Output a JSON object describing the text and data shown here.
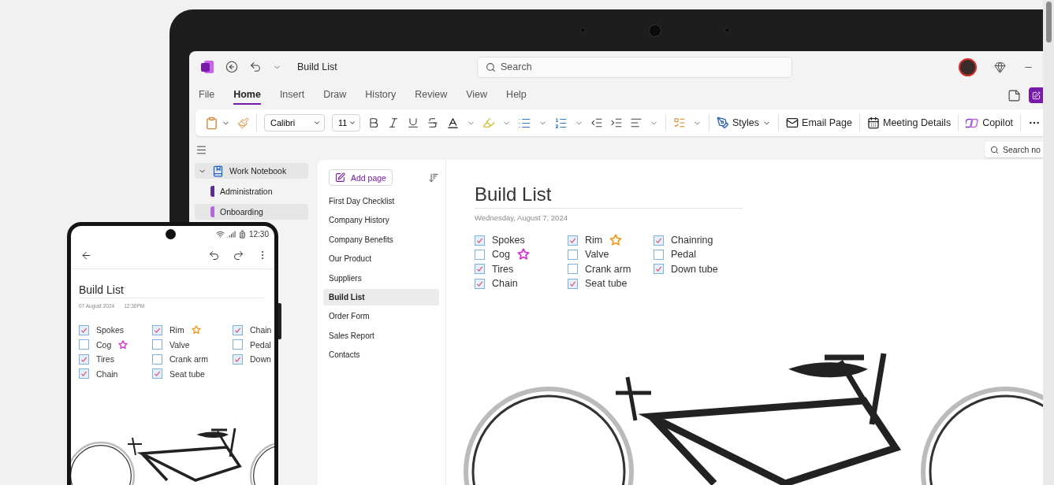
{
  "app": {
    "title": "Build List",
    "search_placeholder": "Search"
  },
  "tabs": [
    {
      "label": "File",
      "selected": false
    },
    {
      "label": "Home",
      "selected": true
    },
    {
      "label": "Insert",
      "selected": false
    },
    {
      "label": "Draw",
      "selected": false
    },
    {
      "label": "History",
      "selected": false
    },
    {
      "label": "Review",
      "selected": false
    },
    {
      "label": "View",
      "selected": false
    },
    {
      "label": "Help",
      "selected": false
    }
  ],
  "ribbon": {
    "font": "Calibri",
    "size": "11",
    "styles": "Styles",
    "actions": [
      {
        "kind": "email",
        "label": "Email Page"
      },
      {
        "kind": "meeting",
        "label": "Meeting Details"
      },
      {
        "kind": "copilot",
        "label": "Copilot"
      }
    ]
  },
  "notes_search": {
    "placeholder": "Search no"
  },
  "notebook": {
    "name": "Work Notebook",
    "expanded": true,
    "sections": [
      {
        "name": "Administration",
        "color": "#5c2d91",
        "selected": false
      },
      {
        "name": "Onboarding",
        "color": "#b46ad6",
        "selected": true
      }
    ]
  },
  "pages": {
    "add_label": "Add page",
    "items": [
      {
        "title": "First Day Checklist",
        "selected": false
      },
      {
        "title": "Company History",
        "selected": false
      },
      {
        "title": "Company Benefits",
        "selected": false
      },
      {
        "title": "Our Product",
        "selected": false
      },
      {
        "title": "Suppliers",
        "selected": false
      },
      {
        "title": "Build List",
        "selected": true
      },
      {
        "title": "Order Form",
        "selected": false
      },
      {
        "title": "Sales Report",
        "selected": false
      },
      {
        "title": "Contacts",
        "selected": false
      }
    ]
  },
  "page": {
    "title": "Build List",
    "date": "Wednesday, August 7, 2024",
    "checklist": [
      [
        {
          "label": "Spokes",
          "checked": true
        },
        {
          "label": "Cog",
          "checked": false,
          "color": "#d92fd0"
        },
        {
          "label": "Tires",
          "checked": true
        },
        {
          "label": "Chain",
          "checked": true
        }
      ],
      [
        {
          "label": "Rim",
          "checked": true,
          "color": "#f59a1b"
        },
        {
          "label": "Valve",
          "checked": false
        },
        {
          "label": "Crank arm",
          "checked": false
        },
        {
          "label": "Seat tube",
          "checked": true
        }
      ],
      [
        {
          "label": "Chainring",
          "checked": true
        },
        {
          "label": "Pedal",
          "checked": false
        },
        {
          "label": "Down tube",
          "checked": true
        }
      ]
    ]
  },
  "phone": {
    "time": "12:30",
    "title": "Build List",
    "date": "07 August 2024",
    "time_note": "12:30PM",
    "checklist": [
      [
        {
          "label": "Spokes",
          "checked": true
        },
        {
          "label": "Cog",
          "checked": false,
          "color": "#d92fd0"
        },
        {
          "label": "Tires",
          "checked": true
        },
        {
          "label": "Chain",
          "checked": true
        }
      ],
      [
        {
          "label": "Rim",
          "checked": true,
          "color": "#f59a1b"
        },
        {
          "label": "Valve",
          "checked": false
        },
        {
          "label": "Crank arm",
          "checked": false
        },
        {
          "label": "Seat tube",
          "checked": true
        }
      ],
      [
        {
          "label": "Chain",
          "checked": true
        },
        {
          "label": "Pedal",
          "checked": false
        },
        {
          "label": "Down",
          "checked": true
        }
      ]
    ]
  }
}
